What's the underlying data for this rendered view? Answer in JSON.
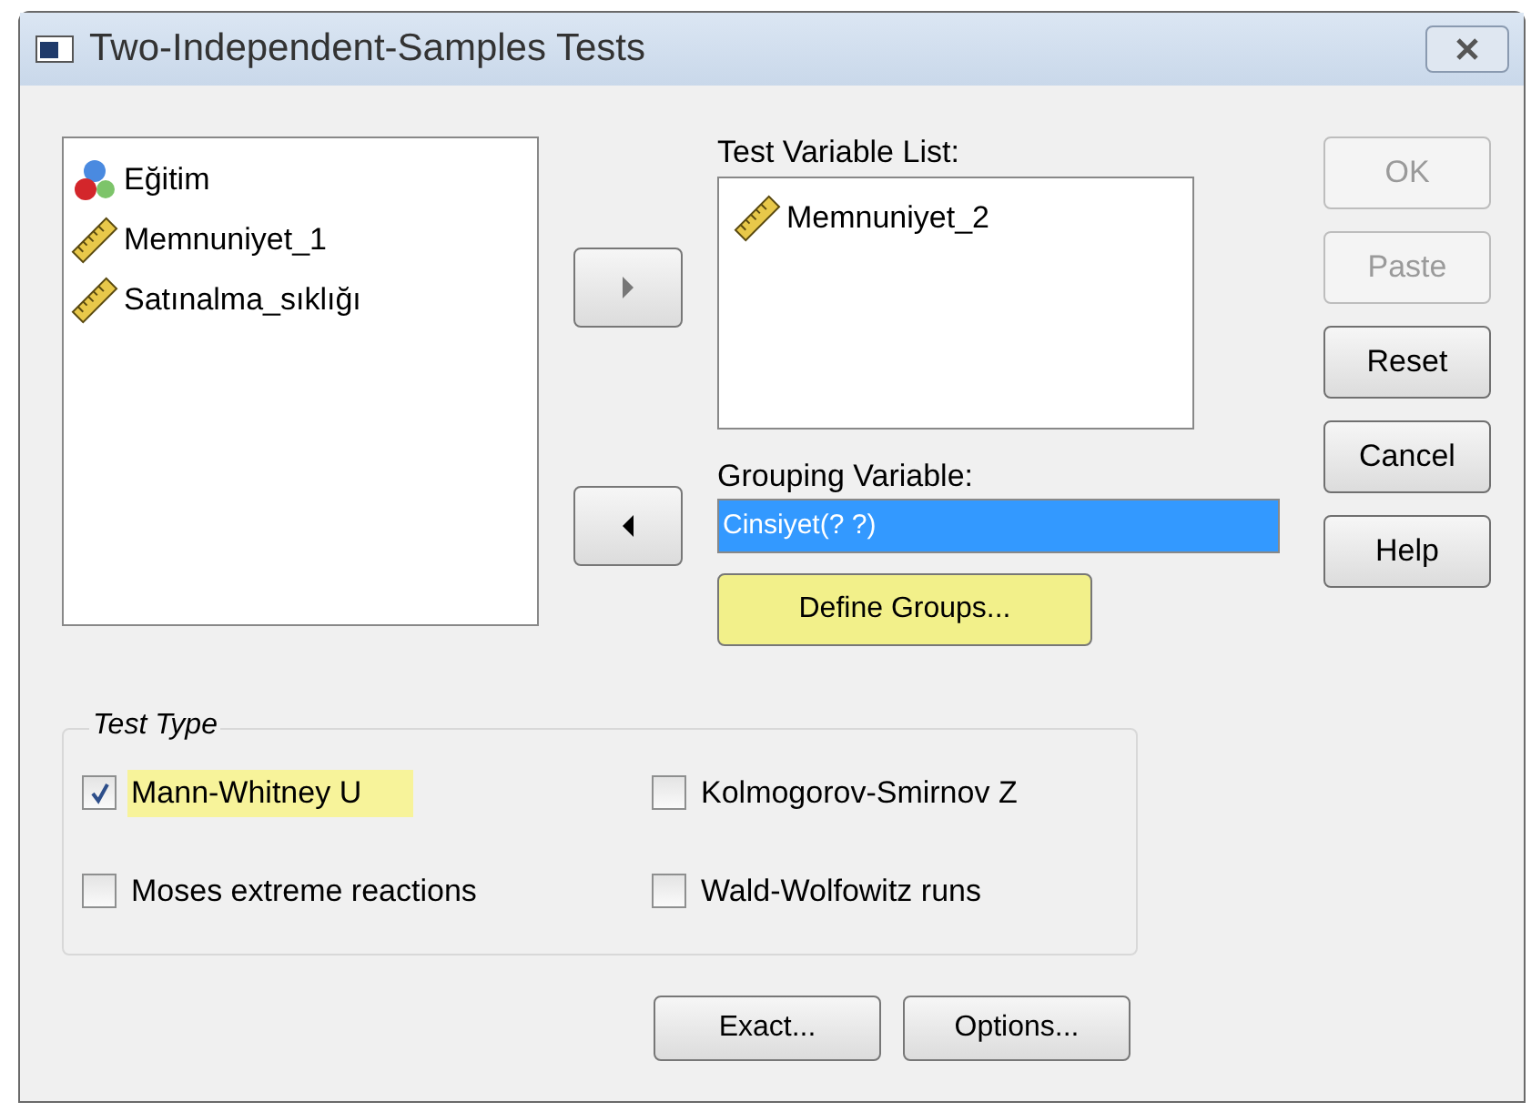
{
  "window": {
    "title": "Two-Independent-Samples Tests"
  },
  "source_list": {
    "items": [
      {
        "label": "Eğitim",
        "kind": "nominal"
      },
      {
        "label": "Memnuniyet_1",
        "kind": "scale"
      },
      {
        "label": "Satınalma_sıklığı",
        "kind": "scale"
      }
    ]
  },
  "move_buttons": [
    {
      "kind": "right"
    },
    {
      "kind": "left"
    }
  ],
  "test_variable_list": {
    "label": "Test Variable List:",
    "items": [
      {
        "label": "Memnuniyet_2",
        "kind": "scale"
      }
    ]
  },
  "grouping_variable": {
    "label": "Grouping Variable:",
    "value": "Cinsiyet(? ?)",
    "selected": true
  },
  "define_groups_button": {
    "label": "Define Groups...",
    "highlighted": true
  },
  "side_buttons": [
    {
      "label": "OK",
      "disabled": true
    },
    {
      "label": "Paste",
      "disabled": true
    },
    {
      "label": "Reset",
      "disabled": false
    },
    {
      "label": "Cancel",
      "disabled": false
    },
    {
      "label": "Help",
      "disabled": false
    }
  ],
  "test_type": {
    "title": "Test Type",
    "options": [
      {
        "label": "Mann-Whitney U",
        "checked": true,
        "highlighted": true
      },
      {
        "label": "Kolmogorov-Smirnov Z",
        "checked": false,
        "highlighted": false
      },
      {
        "label": "Moses extreme reactions",
        "checked": false,
        "highlighted": false
      },
      {
        "label": "Wald-Wolfowitz runs",
        "checked": false,
        "highlighted": false
      }
    ]
  },
  "bottom_buttons": [
    {
      "label": "Exact..."
    },
    {
      "label": "Options..."
    }
  ]
}
